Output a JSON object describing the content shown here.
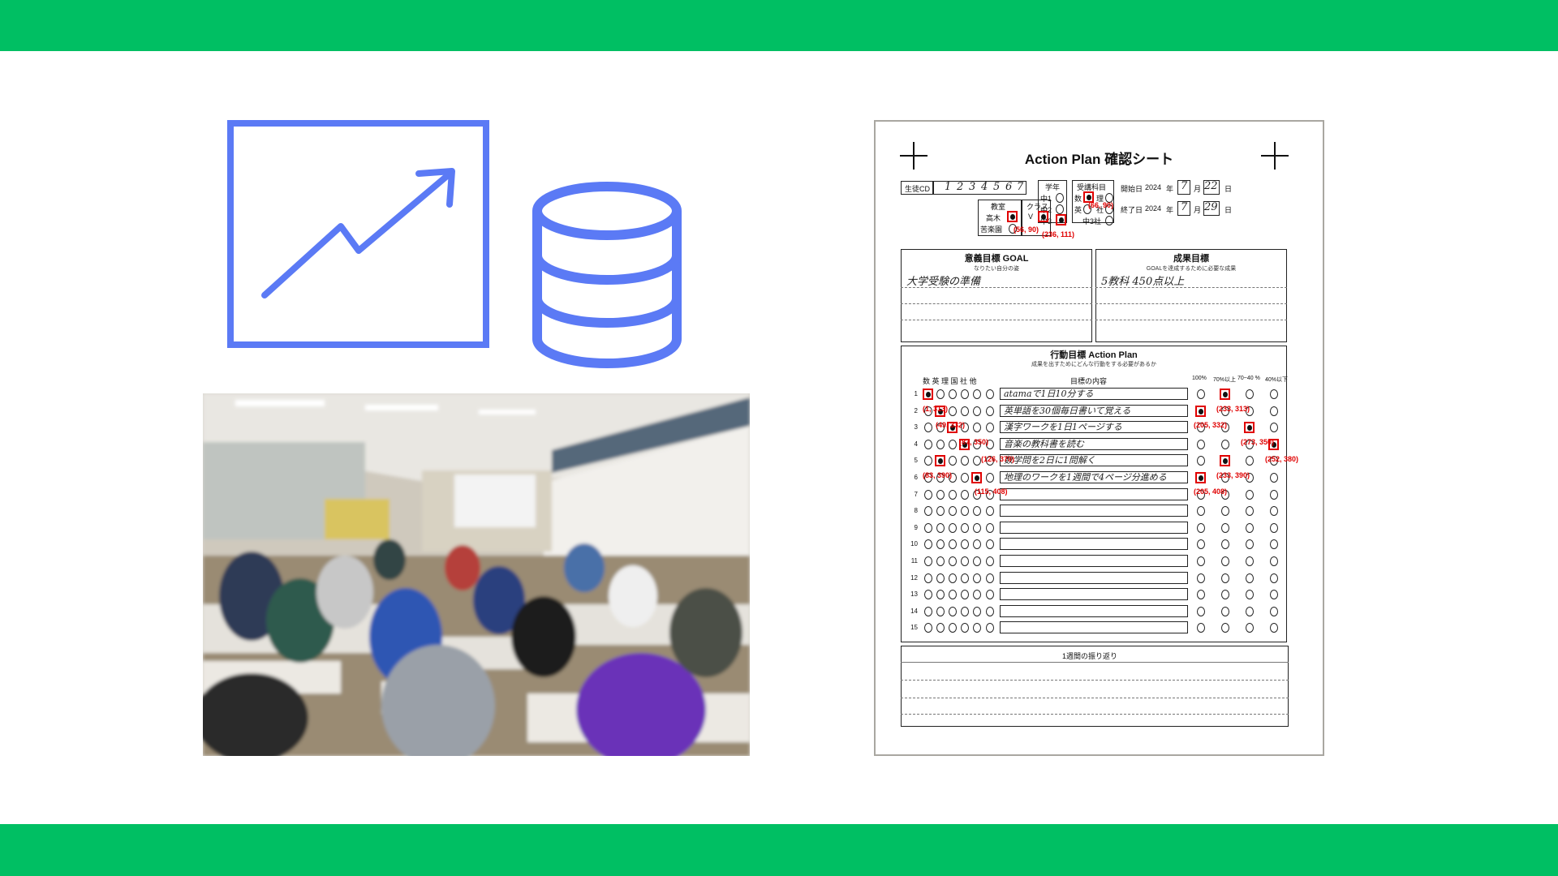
{
  "colors": {
    "band": "#00bf63",
    "icon": "#5b7af5",
    "mark": "#e00000"
  },
  "icons": {
    "chart": "trending-up-chart-icon",
    "database": "database-icon"
  },
  "photo": {
    "subject": "classroom-photo"
  },
  "sheet": {
    "title": "Action Plan 確認シート",
    "student_cd_label": "生徒CD",
    "student_cd_digits": [
      "1",
      "2",
      "3",
      "4",
      "5",
      "6",
      "7"
    ],
    "grade_label": "学年",
    "grades": [
      "中1",
      "中2",
      "中3"
    ],
    "subjects_label": "受講科目",
    "subjects": [
      "数",
      "理",
      "英",
      "社",
      "中3社"
    ],
    "classroom_label": "教室",
    "classrooms": [
      "高木",
      "苦楽園"
    ],
    "class_label": "クラス",
    "class_value": "V",
    "start_label": "開始日",
    "end_label": "終了日",
    "year": "2024",
    "year_unit": "年",
    "month_unit": "月",
    "day_unit": "日",
    "start_month": "7",
    "start_day": "22",
    "end_month": "7",
    "end_day": "29",
    "goal_title": "意義目標 GOAL",
    "goal_sub": "なりたい自分の姿",
    "goal_text": "大学受験の準備",
    "result_title": "成果目標",
    "result_sub": "GOALを達成するために必要な成果",
    "result_text": "5教科 450点以上",
    "action_title": "行動目標 Action Plan",
    "action_sub": "成果を出すためにどんな行動をする必要があるか",
    "col_subjects": "数 英 理 国 社 他",
    "col_content": "目標の内容",
    "col_100": "100%",
    "col_70": "70%以上",
    "col_4070": "70~40 %",
    "col_40": "40%以下",
    "rows": [
      {
        "n": "1",
        "text": "atamaで1日10分する"
      },
      {
        "n": "2",
        "text": "英単語を30個毎日書いて覚える"
      },
      {
        "n": "3",
        "text": "漢字ワークを1日1ページする"
      },
      {
        "n": "4",
        "text": "音楽の教科書を読む"
      },
      {
        "n": "5",
        "text": "数学問を2日に1問解く"
      },
      {
        "n": "6",
        "text": "地理のワークを1週間で4ページ分進める"
      },
      {
        "n": "7",
        "text": ""
      },
      {
        "n": "8",
        "text": ""
      },
      {
        "n": "9",
        "text": ""
      },
      {
        "n": "10",
        "text": ""
      },
      {
        "n": "11",
        "text": ""
      },
      {
        "n": "12",
        "text": ""
      },
      {
        "n": "13",
        "text": ""
      },
      {
        "n": "14",
        "text": ""
      },
      {
        "n": "15",
        "text": ""
      }
    ],
    "review_title": "1週間の振り返り",
    "coords": {
      "a": "(1, 313)",
      "b": "(49, 332)",
      "c": "(87, 350)",
      "d": "(126, 370)",
      "e": "(83, 390)",
      "f": "(115, 408)",
      "g": "(233, 313)",
      "h": "(205, 332)",
      "i": "(273, 350)",
      "j": "(252, 380)",
      "k": "(233, 390)",
      "l": "(205, 408)",
      "m": "(66, 90)",
      "n": "(236, 111)",
      "o": "(56, 90)",
      "p": "(33, 102)"
    }
  }
}
